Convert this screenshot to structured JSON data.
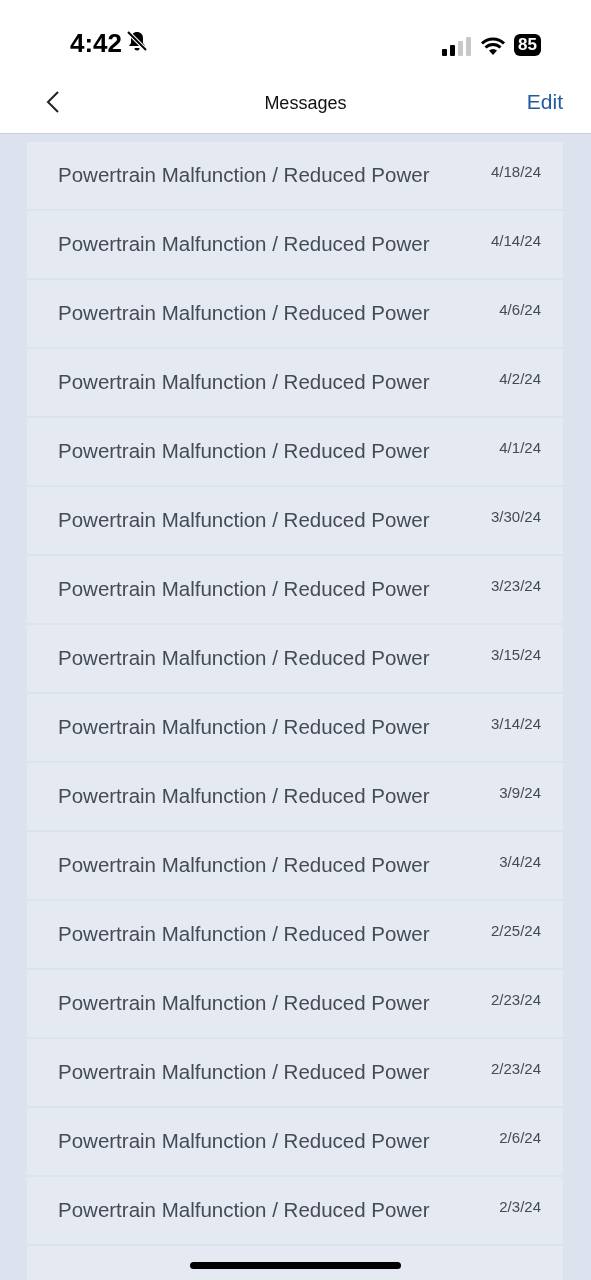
{
  "status_bar": {
    "time": "4:42",
    "battery": "85"
  },
  "nav": {
    "title": "Messages",
    "action": "Edit"
  },
  "messages": [
    {
      "title": "Powertrain Malfunction / Reduced Power",
      "date": "4/18/24"
    },
    {
      "title": "Powertrain Malfunction / Reduced Power",
      "date": "4/14/24"
    },
    {
      "title": "Powertrain Malfunction / Reduced Power",
      "date": "4/6/24"
    },
    {
      "title": "Powertrain Malfunction / Reduced Power",
      "date": "4/2/24"
    },
    {
      "title": "Powertrain Malfunction / Reduced Power",
      "date": "4/1/24"
    },
    {
      "title": "Powertrain Malfunction / Reduced Power",
      "date": "3/30/24"
    },
    {
      "title": "Powertrain Malfunction / Reduced Power",
      "date": "3/23/24"
    },
    {
      "title": "Powertrain Malfunction / Reduced Power",
      "date": "3/15/24"
    },
    {
      "title": "Powertrain Malfunction / Reduced Power",
      "date": "3/14/24"
    },
    {
      "title": "Powertrain Malfunction / Reduced Power",
      "date": "3/9/24"
    },
    {
      "title": "Powertrain Malfunction / Reduced Power",
      "date": "3/4/24"
    },
    {
      "title": "Powertrain Malfunction / Reduced Power",
      "date": "2/25/24"
    },
    {
      "title": "Powertrain Malfunction / Reduced Power",
      "date": "2/23/24"
    },
    {
      "title": "Powertrain Malfunction / Reduced Power",
      "date": "2/23/24"
    },
    {
      "title": "Powertrain Malfunction / Reduced Power",
      "date": "2/6/24"
    },
    {
      "title": "Powertrain Malfunction / Reduced Power",
      "date": "2/3/24"
    }
  ]
}
